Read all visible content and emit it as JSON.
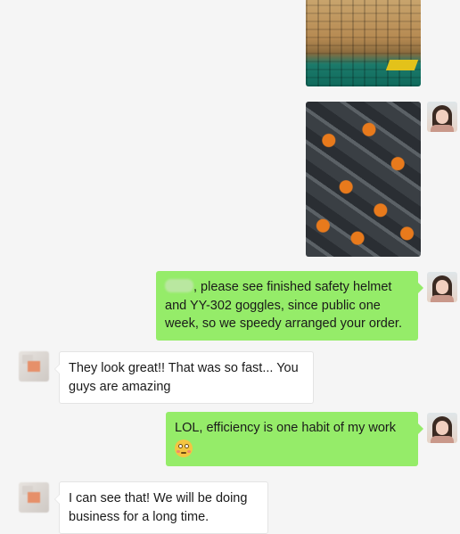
{
  "messages": [
    {
      "side": "out",
      "type": "image",
      "image_desc": "warehouse-boxes-photo"
    },
    {
      "side": "out",
      "type": "image",
      "image_desc": "packaged-goggles-photo"
    },
    {
      "side": "out",
      "type": "text",
      "lines": [
        ", please see finished safety helmet",
        "and YY-302 goggles, since public one",
        "week, so we speedy arranged your order."
      ]
    },
    {
      "side": "in",
      "type": "text",
      "lines": [
        "They look great!! That was so fast... You",
        "guys are amazing"
      ]
    },
    {
      "side": "out",
      "type": "text",
      "lines": [
        "LOL, efficiency is one habit of my work"
      ],
      "emoji": "blush-emoji"
    },
    {
      "side": "in",
      "type": "text",
      "lines": [
        "I can see that! We will be doing",
        "business for a long time."
      ]
    }
  ],
  "colors": {
    "outgoing_bubble": "#95ec69",
    "incoming_bubble": "#ffffff",
    "background": "#f5f5f5"
  }
}
